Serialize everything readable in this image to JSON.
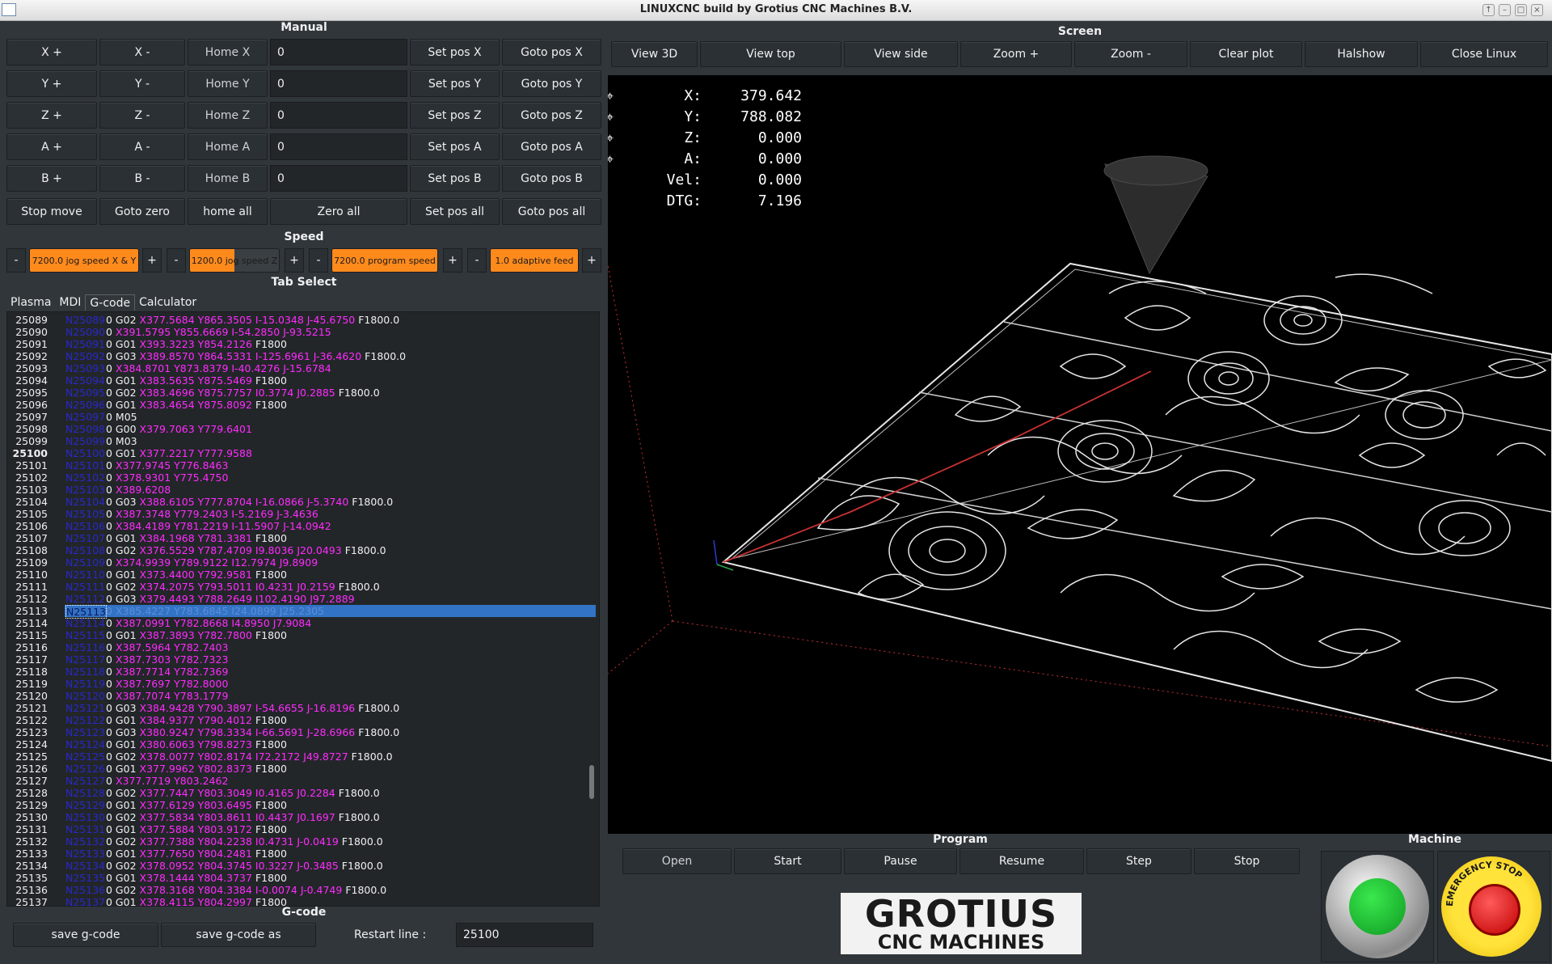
{
  "window": {
    "title": "LINUXCNC build by Grotius CNC Machines B.V."
  },
  "manual": {
    "title": "Manual",
    "rows": [
      {
        "plus": "X +",
        "minus": "X -",
        "home": "Home X",
        "value": "0",
        "setpos": "Set pos X",
        "goto": "Goto pos X"
      },
      {
        "plus": "Y +",
        "minus": "Y -",
        "home": "Home Y",
        "value": "0",
        "setpos": "Set pos Y",
        "goto": "Goto pos Y"
      },
      {
        "plus": "Z +",
        "minus": "Z -",
        "home": "Home Z",
        "value": "0",
        "setpos": "Set pos Z",
        "goto": "Goto pos Z"
      },
      {
        "plus": "A +",
        "minus": "A -",
        "home": "Home A",
        "value": "0",
        "setpos": "Set pos A",
        "goto": "Goto pos A"
      },
      {
        "plus": "B +",
        "minus": "B -",
        "home": "Home B",
        "value": "0",
        "setpos": "Set pos B",
        "goto": "Goto pos B"
      }
    ],
    "bottom": {
      "stop": "Stop move",
      "gotozero": "Goto zero",
      "homeall": "home all",
      "zeroall": "Zero all",
      "setposall": "Set pos all",
      "gotoposall": "Goto pos all"
    }
  },
  "speed": {
    "title": "Speed",
    "minus": "-",
    "plus": "+",
    "bars": [
      {
        "label": "7200.0 jog speed X & Y",
        "fill": 1.0
      },
      {
        "label": "1200.0 jog speed Z",
        "fill": 0.5
      },
      {
        "label": "7200.0 program speed",
        "fill": 1.0
      },
      {
        "label": "1.0 adaptive feed",
        "fill": 1.0
      }
    ]
  },
  "tabselect": {
    "title": "Tab Select",
    "tabs": [
      "Plasma",
      "MDI",
      "G-code",
      "Calculator"
    ],
    "active": "G-code"
  },
  "gcode": {
    "lines": [
      {
        "ln": "25089",
        "n": "N25089",
        "g": "0 G02 ",
        "c": "X377.5684 Y865.3505 I-15.0348 J-45.6750",
        "f": " F1800.0"
      },
      {
        "ln": "25090",
        "n": "N25090",
        "g": "0 ",
        "c": "X391.5795 Y855.6669 I-54.2850 J-93.5215",
        "f": ""
      },
      {
        "ln": "25091",
        "n": "N25091",
        "g": "0 G01 ",
        "c": "X393.3223 Y854.2126",
        "f": " F1800"
      },
      {
        "ln": "25092",
        "n": "N25092",
        "g": "0 G03 ",
        "c": "X389.8570 Y864.5331 I-125.6961 J-36.4620",
        "f": " F1800.0"
      },
      {
        "ln": "25093",
        "n": "N25093",
        "g": "0 ",
        "c": "X384.8701 Y873.8379 I-40.4276 J-15.6784",
        "f": ""
      },
      {
        "ln": "25094",
        "n": "N25094",
        "g": "0 G01 ",
        "c": "X383.5635 Y875.5469",
        "f": " F1800"
      },
      {
        "ln": "25095",
        "n": "N25095",
        "g": "0 G02 ",
        "c": "X383.4696 Y875.7757 I0.3774 J0.2885",
        "f": " F1800.0"
      },
      {
        "ln": "25096",
        "n": "N25096",
        "g": "0 G01 ",
        "c": "X383.4654 Y875.8092",
        "f": " F1800"
      },
      {
        "ln": "25097",
        "n": "N25097",
        "g": "0 M05",
        "c": "",
        "f": ""
      },
      {
        "ln": "25098",
        "n": "N25098",
        "g": "0 G00 ",
        "c": "X379.7063 Y779.6401",
        "f": ""
      },
      {
        "ln": "25099",
        "n": "N25099",
        "g": "0 M03",
        "c": "",
        "f": ""
      },
      {
        "ln": "25100",
        "n": "N25100",
        "g": "0 G01 ",
        "c": "X377.2217 Y777.9588",
        "f": "",
        "bold": true
      },
      {
        "ln": "25101",
        "n": "N25101",
        "g": "0 ",
        "c": "X377.9745 Y776.8463",
        "f": ""
      },
      {
        "ln": "25102",
        "n": "N25102",
        "g": "0 ",
        "c": "X378.9301 Y775.4750",
        "f": ""
      },
      {
        "ln": "25103",
        "n": "N25103",
        "g": "0 ",
        "c": "X389.6208",
        "f": ""
      },
      {
        "ln": "25104",
        "n": "N25104",
        "g": "0 G03 ",
        "c": "X388.6105 Y777.8704 I-16.0866 J-5.3740",
        "f": " F1800.0"
      },
      {
        "ln": "25105",
        "n": "N25105",
        "g": "0 ",
        "c": "X387.3748 Y779.2403 I-5.2169 J-3.4636",
        "f": ""
      },
      {
        "ln": "25106",
        "n": "N25106",
        "g": "0 ",
        "c": "X384.4189 Y781.2219 I-11.5907 J-14.0942",
        "f": ""
      },
      {
        "ln": "25107",
        "n": "N25107",
        "g": "0 G01 ",
        "c": "X384.1968 Y781.3381",
        "f": " F1800"
      },
      {
        "ln": "25108",
        "n": "N25108",
        "g": "0 G02 ",
        "c": "X376.5529 Y787.4709 I9.8036 J20.0493",
        "f": " F1800.0"
      },
      {
        "ln": "25109",
        "n": "N25109",
        "g": "0 ",
        "c": "X374.9939 Y789.9122 I12.7974 J9.8909",
        "f": ""
      },
      {
        "ln": "25110",
        "n": "N25110",
        "g": "0 G01 ",
        "c": "X373.4400 Y792.9581",
        "f": " F1800"
      },
      {
        "ln": "25111",
        "n": "N25111",
        "g": "0 G02 ",
        "c": "X374.2075 Y793.5011 I0.4231 J0.2159",
        "f": " F1800.0"
      },
      {
        "ln": "25112",
        "n": "N25112",
        "g": "0 G03 ",
        "c": "X379.4493 Y788.2649 I102.4190 J97.2889",
        "f": ""
      },
      {
        "ln": "25113",
        "n": "N25113",
        "g": "0 ",
        "c": "X385.4227 Y783.6845 I24.0899 J25.2305",
        "f": "",
        "sel": true
      },
      {
        "ln": "25114",
        "n": "N25114",
        "g": "0 ",
        "c": "X387.0991 Y782.8668 I4.8950 J7.9084",
        "f": ""
      },
      {
        "ln": "25115",
        "n": "N25115",
        "g": "0 G01 ",
        "c": "X387.3893 Y782.7800",
        "f": " F1800"
      },
      {
        "ln": "25116",
        "n": "N25116",
        "g": "0 ",
        "c": "X387.5964 Y782.7403",
        "f": ""
      },
      {
        "ln": "25117",
        "n": "N25117",
        "g": "0 ",
        "c": "X387.7303 Y782.7323",
        "f": ""
      },
      {
        "ln": "25118",
        "n": "N25118",
        "g": "0 ",
        "c": "X387.7714 Y782.7369",
        "f": ""
      },
      {
        "ln": "25119",
        "n": "N25119",
        "g": "0 ",
        "c": "X387.7697 Y782.8000",
        "f": ""
      },
      {
        "ln": "25120",
        "n": "N25120",
        "g": "0 ",
        "c": "X387.7074 Y783.1779",
        "f": ""
      },
      {
        "ln": "25121",
        "n": "N25121",
        "g": "0 G03 ",
        "c": "X384.9428 Y790.3897 I-54.6655 J-16.8196",
        "f": " F1800.0"
      },
      {
        "ln": "25122",
        "n": "N25122",
        "g": "0 G01 ",
        "c": "X384.9377 Y790.4012",
        "f": " F1800"
      },
      {
        "ln": "25123",
        "n": "N25123",
        "g": "0 G03 ",
        "c": "X380.9247 Y798.3334 I-66.5691 J-28.6966",
        "f": " F1800.0"
      },
      {
        "ln": "25124",
        "n": "N25124",
        "g": "0 G01 ",
        "c": "X380.6063 Y798.8273",
        "f": " F1800"
      },
      {
        "ln": "25125",
        "n": "N25125",
        "g": "0 G02 ",
        "c": "X378.0077 Y802.8174 I72.2172 J49.8727",
        "f": " F1800.0"
      },
      {
        "ln": "25126",
        "n": "N25126",
        "g": "0 G01 ",
        "c": "X377.9962 Y802.8373",
        "f": " F1800"
      },
      {
        "ln": "25127",
        "n": "N25127",
        "g": "0 ",
        "c": "X377.7719 Y803.2462",
        "f": ""
      },
      {
        "ln": "25128",
        "n": "N25128",
        "g": "0 G02 ",
        "c": "X377.7447 Y803.3049 I0.4165 J0.2284",
        "f": " F1800.0"
      },
      {
        "ln": "25129",
        "n": "N25129",
        "g": "0 G01 ",
        "c": "X377.6129 Y803.6495",
        "f": " F1800"
      },
      {
        "ln": "25130",
        "n": "N25130",
        "g": "0 G02 ",
        "c": "X377.5834 Y803.8611 I0.4437 J0.1697",
        "f": " F1800.0"
      },
      {
        "ln": "25131",
        "n": "N25131",
        "g": "0 G01 ",
        "c": "X377.5884 Y803.9172",
        "f": " F1800"
      },
      {
        "ln": "25132",
        "n": "N25132",
        "g": "0 G02 ",
        "c": "X377.7388 Y804.2238 I0.4731 J-0.0419",
        "f": " F1800.0"
      },
      {
        "ln": "25133",
        "n": "N25133",
        "g": "0 G01 ",
        "c": "X377.7650 Y804.2481",
        "f": " F1800"
      },
      {
        "ln": "25134",
        "n": "N25134",
        "g": "0 G02 ",
        "c": "X378.0952 Y804.3745 I0.3227 J-0.3485",
        "f": " F1800.0"
      },
      {
        "ln": "25135",
        "n": "N25135",
        "g": "0 G01 ",
        "c": "X378.1444 Y804.3737",
        "f": " F1800"
      },
      {
        "ln": "25136",
        "n": "N25136",
        "g": "0 G02 ",
        "c": "X378.3168 Y804.3384 I-0.0074 J-0.4749",
        "f": " F1800.0"
      },
      {
        "ln": "25137",
        "n": "N25137",
        "g": "0 G01 ",
        "c": "X378.4115 Y804.2997",
        "f": " F1800"
      }
    ],
    "footer": {
      "title": "G-code",
      "save": "save g-code",
      "saveas": "save g-code as",
      "restart_label": "Restart line :",
      "restart_value": "25100"
    }
  },
  "screen": {
    "title": "Screen",
    "buttons": [
      "View 3D",
      "View top",
      "View side",
      "Zoom +",
      "Zoom -",
      "Clear plot",
      "Halshow",
      "Close Linux"
    ]
  },
  "dro": {
    "rows": [
      {
        "label": "X:",
        "value": "379.642",
        "marker": "⌖"
      },
      {
        "label": "Y:",
        "value": "788.082",
        "marker": "⌖"
      },
      {
        "label": "Z:",
        "value": "0.000",
        "marker": "⌖"
      },
      {
        "label": "A:",
        "value": "0.000",
        "marker": "⌖"
      },
      {
        "label": "Vel:",
        "value": "0.000",
        "marker": ""
      },
      {
        "label": "DTG:",
        "value": "7.196",
        "marker": ""
      }
    ]
  },
  "program": {
    "title": "Program",
    "buttons": [
      "Open",
      "Start",
      "Pause",
      "Resume",
      "Step",
      "Stop"
    ]
  },
  "machine": {
    "title": "Machine",
    "estop_text": "EMERGENCY STOP"
  },
  "logo": {
    "line1": "GROTIUS",
    "line2": "CNC MACHINES"
  },
  "colors": {
    "accent": "#ff8a1c",
    "selection": "#3273c6",
    "gcode_coords": "#ff2bff",
    "gcode_n": "#2828c8",
    "toolpath": "#c83232"
  }
}
